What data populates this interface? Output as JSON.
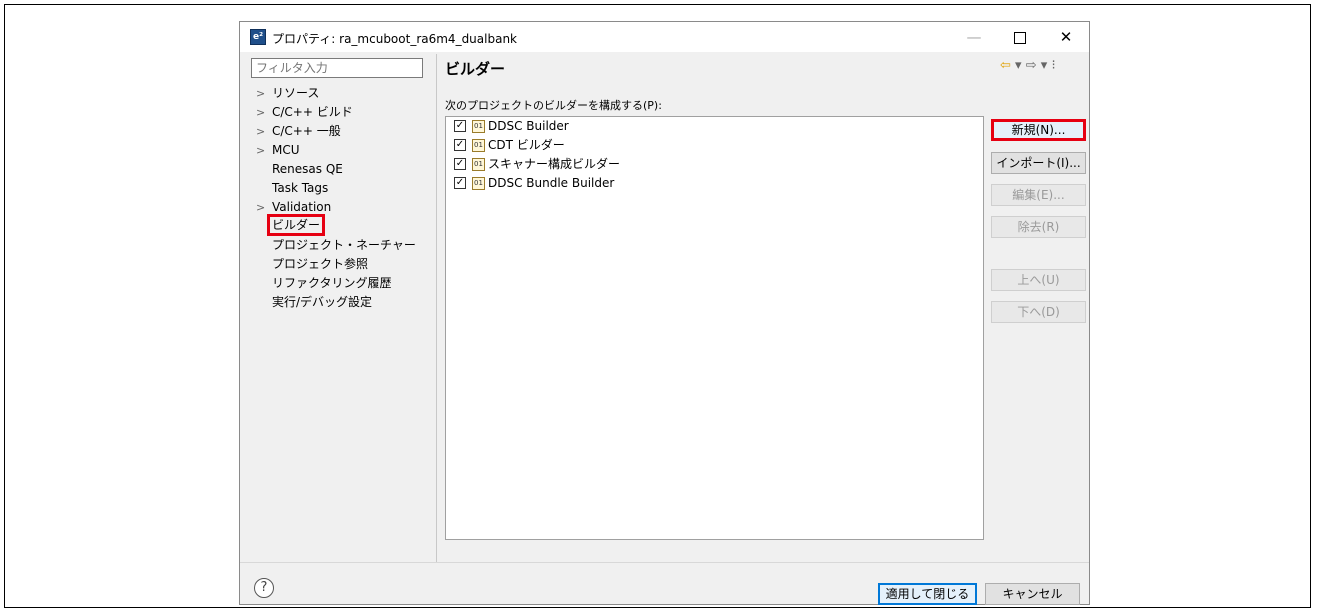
{
  "window": {
    "title": "プロパティ: ra_mcuboot_ra6m4_dualbank",
    "app_icon": "e²",
    "min_glyph": "—",
    "close_glyph": "✕"
  },
  "filter": {
    "placeholder": "フィルタ入力"
  },
  "tree": {
    "items": [
      {
        "label": "リソース",
        "expandable": true
      },
      {
        "label": "C/C++ ビルド",
        "expandable": true
      },
      {
        "label": "C/C++ 一般",
        "expandable": true
      },
      {
        "label": "MCU",
        "expandable": true
      },
      {
        "label": "Renesas QE",
        "expandable": false
      },
      {
        "label": "Task Tags",
        "expandable": false
      },
      {
        "label": "Validation",
        "expandable": true
      },
      {
        "label": "ビルダー",
        "expandable": false,
        "selected": true
      },
      {
        "label": "プロジェクト・ネーチャー",
        "expandable": false
      },
      {
        "label": "プロジェクト参照",
        "expandable": false
      },
      {
        "label": "リファクタリング履歴",
        "expandable": false
      },
      {
        "label": "実行/デバッグ設定",
        "expandable": false
      }
    ]
  },
  "page": {
    "title": "ビルダー",
    "prompt": "次のプロジェクトのビルダーを構成する(P):",
    "nav": {
      "back": "⇦",
      "menu": "▾",
      "forward": "⇨",
      "more": "⁝"
    }
  },
  "builders": [
    {
      "name": "DDSC Builder",
      "checked": true
    },
    {
      "name": "CDT ビルダー",
      "checked": true
    },
    {
      "name": "スキャナー構成ビルダー",
      "checked": true
    },
    {
      "name": "DDSC Bundle Builder",
      "checked": true
    }
  ],
  "buttons": {
    "new": "新規(N)...",
    "import": "インポート(I)...",
    "edit": "編集(E)...",
    "remove": "除去(R)",
    "up": "上へ(U)",
    "down": "下へ(D)",
    "apply_close": "適用して閉じる",
    "cancel": "キャンセル"
  },
  "icons": {
    "checkmark": "✓",
    "file_badge": "01",
    "help": "?",
    "tree_arrow": ">"
  }
}
